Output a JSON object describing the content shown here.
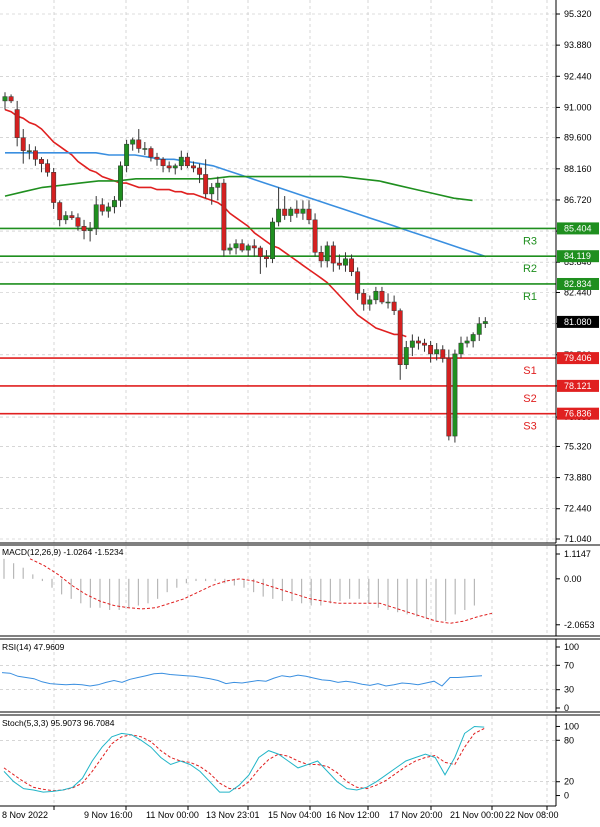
{
  "chart_data": {
    "type": "candlestick",
    "symbol": "",
    "x_tick_labels": [
      "8 Nov 2022",
      "9 Nov 16:00",
      "11 Nov 00:00",
      "13 Nov 23:01",
      "15 Nov 04:00",
      "16 Nov 12:00",
      "17 Nov 20:00",
      "21 Nov 00:00",
      "22 Nov 08:00"
    ],
    "price_axis": {
      "ylim": [
        71.04,
        96.2
      ],
      "tick_labels": [
        "95.320",
        "93.880",
        "92.440",
        "91.000",
        "89.600",
        "88.160",
        "86.720",
        "85.280",
        "83.840",
        "82.440",
        "81.000",
        "79.560",
        "78.120",
        "76.680",
        "75.320",
        "73.880",
        "72.440",
        "71.040"
      ],
      "last_price": "81.080",
      "last_price_value": 81.08
    },
    "levels": [
      {
        "name": "R3",
        "label": "85.404",
        "value": 85.404,
        "color": "#1f8f1f"
      },
      {
        "name": "R2",
        "label": "84.119",
        "value": 84.119,
        "color": "#1f8f1f"
      },
      {
        "name": "R1",
        "label": "82.834",
        "value": 82.834,
        "color": "#1f8f1f"
      },
      {
        "name": "S1",
        "label": "79.406",
        "value": 79.406,
        "color": "#e02020"
      },
      {
        "name": "S2",
        "label": "78.121",
        "value": 78.121,
        "color": "#e02020"
      },
      {
        "name": "S3",
        "label": "76.836",
        "value": 76.836,
        "color": "#e02020"
      }
    ],
    "candles": [
      {
        "o": 91.3,
        "h": 91.7,
        "l": 90.9,
        "c": 91.5
      },
      {
        "o": 91.5,
        "h": 91.6,
        "l": 91.2,
        "c": 91.3
      },
      {
        "o": 90.9,
        "h": 91.3,
        "l": 89.2,
        "c": 89.6
      },
      {
        "o": 89.6,
        "h": 90.0,
        "l": 88.4,
        "c": 89.0
      },
      {
        "o": 89.0,
        "h": 89.3,
        "l": 88.6,
        "c": 89.0
      },
      {
        "o": 89.0,
        "h": 89.2,
        "l": 88.3,
        "c": 88.6
      },
      {
        "o": 88.6,
        "h": 88.7,
        "l": 88.0,
        "c": 88.4
      },
      {
        "o": 88.4,
        "h": 88.6,
        "l": 87.8,
        "c": 88.0
      },
      {
        "o": 88.0,
        "h": 88.2,
        "l": 86.3,
        "c": 86.6
      },
      {
        "o": 86.6,
        "h": 86.7,
        "l": 85.5,
        "c": 85.8
      },
      {
        "o": 85.8,
        "h": 86.2,
        "l": 85.6,
        "c": 86.0
      },
      {
        "o": 86.0,
        "h": 86.2,
        "l": 85.8,
        "c": 85.9
      },
      {
        "o": 85.9,
        "h": 86.1,
        "l": 85.3,
        "c": 85.5
      },
      {
        "o": 85.5,
        "h": 85.8,
        "l": 84.9,
        "c": 85.3
      },
      {
        "o": 85.3,
        "h": 85.7,
        "l": 84.8,
        "c": 85.4
      },
      {
        "o": 85.4,
        "h": 86.9,
        "l": 85.1,
        "c": 86.5
      },
      {
        "o": 86.5,
        "h": 86.8,
        "l": 86.0,
        "c": 86.2
      },
      {
        "o": 86.2,
        "h": 86.6,
        "l": 85.9,
        "c": 86.4
      },
      {
        "o": 86.4,
        "h": 86.9,
        "l": 86.1,
        "c": 86.7
      },
      {
        "o": 86.7,
        "h": 88.5,
        "l": 86.4,
        "c": 88.3
      },
      {
        "o": 88.3,
        "h": 89.5,
        "l": 88.0,
        "c": 89.3
      },
      {
        "o": 89.3,
        "h": 89.6,
        "l": 89.0,
        "c": 89.5
      },
      {
        "o": 89.5,
        "h": 90.0,
        "l": 88.9,
        "c": 89.1
      },
      {
        "o": 89.1,
        "h": 89.4,
        "l": 88.8,
        "c": 89.1
      },
      {
        "o": 89.1,
        "h": 89.2,
        "l": 88.5,
        "c": 88.7
      },
      {
        "o": 88.7,
        "h": 88.9,
        "l": 88.3,
        "c": 88.6
      },
      {
        "o": 88.6,
        "h": 88.7,
        "l": 88.0,
        "c": 88.3
      },
      {
        "o": 88.3,
        "h": 88.5,
        "l": 88.0,
        "c": 88.2
      },
      {
        "o": 88.2,
        "h": 88.4,
        "l": 87.9,
        "c": 88.3
      },
      {
        "o": 88.3,
        "h": 89.0,
        "l": 88.1,
        "c": 88.7
      },
      {
        "o": 88.7,
        "h": 88.9,
        "l": 88.2,
        "c": 88.3
      },
      {
        "o": 88.3,
        "h": 88.5,
        "l": 88.0,
        "c": 88.2
      },
      {
        "o": 88.2,
        "h": 88.4,
        "l": 87.5,
        "c": 87.9
      },
      {
        "o": 87.9,
        "h": 88.6,
        "l": 86.8,
        "c": 87.0
      },
      {
        "o": 87.0,
        "h": 87.5,
        "l": 86.5,
        "c": 87.3
      },
      {
        "o": 87.3,
        "h": 87.8,
        "l": 86.7,
        "c": 87.5
      },
      {
        "o": 87.5,
        "h": 87.7,
        "l": 84.1,
        "c": 84.4
      },
      {
        "o": 84.4,
        "h": 84.7,
        "l": 84.2,
        "c": 84.5
      },
      {
        "o": 84.5,
        "h": 84.9,
        "l": 84.2,
        "c": 84.7
      },
      {
        "o": 84.7,
        "h": 84.9,
        "l": 84.3,
        "c": 84.4
      },
      {
        "o": 84.4,
        "h": 84.7,
        "l": 84.1,
        "c": 84.6
      },
      {
        "o": 84.6,
        "h": 84.9,
        "l": 84.1,
        "c": 84.5
      },
      {
        "o": 84.5,
        "h": 84.6,
        "l": 83.3,
        "c": 84.1
      },
      {
        "o": 84.1,
        "h": 84.4,
        "l": 83.6,
        "c": 84.0
      },
      {
        "o": 84.0,
        "h": 85.9,
        "l": 83.8,
        "c": 85.7
      },
      {
        "o": 85.7,
        "h": 87.3,
        "l": 85.5,
        "c": 86.3
      },
      {
        "o": 86.3,
        "h": 86.9,
        "l": 85.8,
        "c": 86.0
      },
      {
        "o": 86.0,
        "h": 86.4,
        "l": 85.7,
        "c": 86.3
      },
      {
        "o": 86.3,
        "h": 86.7,
        "l": 85.9,
        "c": 86.1
      },
      {
        "o": 86.1,
        "h": 86.7,
        "l": 85.8,
        "c": 86.3
      },
      {
        "o": 86.3,
        "h": 86.7,
        "l": 85.6,
        "c": 85.8
      },
      {
        "o": 85.8,
        "h": 86.1,
        "l": 84.1,
        "c": 84.3
      },
      {
        "o": 84.3,
        "h": 84.6,
        "l": 83.6,
        "c": 83.9
      },
      {
        "o": 83.9,
        "h": 84.8,
        "l": 83.6,
        "c": 84.6
      },
      {
        "o": 84.6,
        "h": 84.8,
        "l": 83.4,
        "c": 83.8
      },
      {
        "o": 83.8,
        "h": 84.2,
        "l": 83.5,
        "c": 83.7
      },
      {
        "o": 83.7,
        "h": 84.3,
        "l": 83.4,
        "c": 84.0
      },
      {
        "o": 84.0,
        "h": 84.2,
        "l": 83.2,
        "c": 83.4
      },
      {
        "o": 83.4,
        "h": 83.6,
        "l": 82.1,
        "c": 82.4
      },
      {
        "o": 82.4,
        "h": 82.6,
        "l": 81.6,
        "c": 81.9
      },
      {
        "o": 81.9,
        "h": 82.3,
        "l": 81.6,
        "c": 82.1
      },
      {
        "o": 82.1,
        "h": 82.7,
        "l": 81.9,
        "c": 82.5
      },
      {
        "o": 82.5,
        "h": 82.7,
        "l": 81.9,
        "c": 82.0
      },
      {
        "o": 82.0,
        "h": 82.4,
        "l": 81.7,
        "c": 82.0
      },
      {
        "o": 82.0,
        "h": 82.3,
        "l": 81.4,
        "c": 81.6
      },
      {
        "o": 81.6,
        "h": 81.7,
        "l": 78.4,
        "c": 79.1
      },
      {
        "o": 79.1,
        "h": 80.2,
        "l": 78.9,
        "c": 79.9
      },
      {
        "o": 79.9,
        "h": 80.5,
        "l": 79.5,
        "c": 80.2
      },
      {
        "o": 80.2,
        "h": 80.4,
        "l": 79.8,
        "c": 80.1
      },
      {
        "o": 80.1,
        "h": 80.3,
        "l": 79.7,
        "c": 80.0
      },
      {
        "o": 80.0,
        "h": 80.2,
        "l": 79.2,
        "c": 79.6
      },
      {
        "o": 79.6,
        "h": 80.1,
        "l": 79.3,
        "c": 79.8
      },
      {
        "o": 79.8,
        "h": 80.0,
        "l": 79.2,
        "c": 79.4
      },
      {
        "o": 79.4,
        "h": 79.8,
        "l": 75.6,
        "c": 75.8
      },
      {
        "o": 75.8,
        "h": 79.8,
        "l": 75.5,
        "c": 79.6
      },
      {
        "o": 79.6,
        "h": 80.4,
        "l": 79.4,
        "c": 80.1
      },
      {
        "o": 80.1,
        "h": 80.4,
        "l": 79.9,
        "c": 80.2
      },
      {
        "o": 80.2,
        "h": 80.6,
        "l": 79.9,
        "c": 80.5
      },
      {
        "o": 80.5,
        "h": 81.3,
        "l": 80.2,
        "c": 81.0
      },
      {
        "o": 81.0,
        "h": 81.3,
        "l": 80.8,
        "c": 81.1
      }
    ],
    "moving_averages": [
      {
        "color": "#e02020",
        "values": [
          90.9,
          90.8,
          90.6,
          90.5,
          90.3,
          90.2,
          90.0,
          89.7,
          89.4,
          89.2,
          89.0,
          88.8,
          88.5,
          88.3,
          88.1,
          88.0,
          87.8,
          87.7,
          87.6,
          87.5,
          87.5,
          87.4,
          87.3,
          87.3,
          87.3,
          87.2,
          87.2,
          87.2,
          87.1,
          87.1,
          87.0,
          87.0,
          86.9,
          86.8,
          86.7,
          86.6,
          86.4,
          86.1,
          85.9,
          85.7,
          85.5,
          85.2,
          85.0,
          84.8,
          84.6,
          84.5,
          84.3,
          84.1,
          83.9,
          83.7,
          83.5,
          83.3,
          83.1,
          82.9,
          82.6,
          82.3,
          82.0,
          81.7,
          81.4,
          81.2,
          81.0,
          80.8,
          80.7,
          80.6,
          80.5,
          80.5,
          80.4
        ]
      },
      {
        "color": "#3a8fe0",
        "values": [
          88.9,
          88.9,
          88.9,
          88.9,
          88.9,
          88.9,
          88.9,
          88.9,
          88.8,
          88.8,
          88.8,
          88.7,
          88.6,
          88.6,
          88.5,
          88.4,
          88.3,
          88.1,
          87.9,
          87.7,
          87.5,
          87.3,
          87.1,
          86.9,
          86.7,
          86.5,
          86.3,
          86.1,
          85.9,
          85.7,
          85.5,
          85.3,
          85.1,
          84.9,
          84.7,
          84.5,
          84.3,
          84.1
        ]
      },
      {
        "color": "#1f8f1f",
        "values": [
          86.9,
          87.1,
          87.3,
          87.4,
          87.5,
          87.6,
          87.6,
          87.7,
          87.7,
          87.7,
          87.7,
          87.7,
          87.8,
          87.8,
          87.8,
          87.8,
          87.8,
          87.8,
          87.8,
          87.7,
          87.6,
          87.4,
          87.2,
          87.0,
          86.8,
          86.7
        ]
      }
    ],
    "macd": {
      "label": "MACD(12,26,9) -1.0264 -1.5234",
      "tick_labels": [
        "1.1147",
        "0.00",
        "-2.0653"
      ],
      "ylim": [
        -2.3,
        1.25
      ],
      "histogram": [
        0.9,
        0.7,
        0.5,
        0.2,
        -0.1,
        -0.4,
        -0.7,
        -0.9,
        -1.1,
        -1.3,
        -1.3,
        -1.4,
        -1.4,
        -1.3,
        -1.2,
        -1.1,
        -0.9,
        -0.6,
        -0.4,
        -0.2,
        -0.1,
        -0.1,
        -0.1,
        -0.2,
        -0.3,
        -0.4,
        -0.6,
        -0.8,
        -0.9,
        -1.0,
        -1.0,
        -1.1,
        -1.2,
        -1.2,
        -1.1,
        -1.0,
        -0.9,
        -0.9,
        -1.1,
        -1.3,
        -1.4,
        -1.5,
        -1.6,
        -1.7,
        -1.8,
        -1.9,
        -1.9,
        -1.6,
        -1.4,
        -1.2
      ],
      "signal": [
        0.9,
        0.6,
        0.2,
        -0.3,
        -0.7,
        -1.0,
        -1.2,
        -1.3,
        -1.35,
        -1.3,
        -1.1,
        -0.9,
        -0.6,
        -0.3,
        -0.1,
        0.0,
        -0.1,
        -0.3,
        -0.5,
        -0.7,
        -0.9,
        -1.0,
        -1.1,
        -1.1,
        -1.1,
        -1.1,
        -1.3,
        -1.5,
        -1.7,
        -1.9,
        -2.0,
        -1.9,
        -1.7,
        -1.55
      ]
    },
    "rsi": {
      "label": "RSI(14) 47.9609",
      "tick_labels": [
        "100",
        "70",
        "30",
        "0"
      ],
      "ylim": [
        0,
        100
      ],
      "values": [
        58,
        57,
        52,
        50,
        48,
        43,
        40,
        39,
        38,
        39,
        38,
        36,
        38,
        42,
        45,
        42,
        47,
        50,
        53,
        56,
        57,
        55,
        54,
        53,
        52,
        50,
        48,
        45,
        40,
        42,
        41,
        43,
        45,
        44,
        49,
        53,
        51,
        54,
        52,
        49,
        46,
        45,
        42,
        44,
        42,
        39,
        37,
        40,
        36,
        38,
        41,
        40,
        38,
        41,
        44,
        36,
        50,
        50,
        51,
        52,
        53
      ]
    },
    "stoch": {
      "label": "Stoch(5,3,3) 95.9073 96.7084",
      "tick_labels": [
        "100",
        "80",
        "20",
        "0"
      ],
      "ylim": [
        -5,
        105
      ],
      "k": [
        35,
        20,
        10,
        8,
        5,
        6,
        8,
        12,
        25,
        50,
        70,
        85,
        90,
        88,
        80,
        70,
        55,
        45,
        50,
        45,
        35,
        20,
        5,
        5,
        15,
        30,
        55,
        65,
        60,
        50,
        40,
        45,
        50,
        35,
        20,
        10,
        8,
        12,
        20,
        30,
        40,
        50,
        55,
        60,
        55,
        30,
        55,
        90,
        100,
        99
      ],
      "d": [
        40,
        30,
        20,
        12,
        9,
        7,
        8,
        11,
        18,
        35,
        55,
        75,
        85,
        88,
        85,
        78,
        65,
        55,
        50,
        48,
        42,
        32,
        18,
        10,
        10,
        20,
        38,
        52,
        60,
        57,
        50,
        45,
        45,
        42,
        33,
        20,
        12,
        10,
        15,
        22,
        32,
        42,
        50,
        55,
        58,
        48,
        45,
        70,
        90,
        97
      ]
    }
  }
}
